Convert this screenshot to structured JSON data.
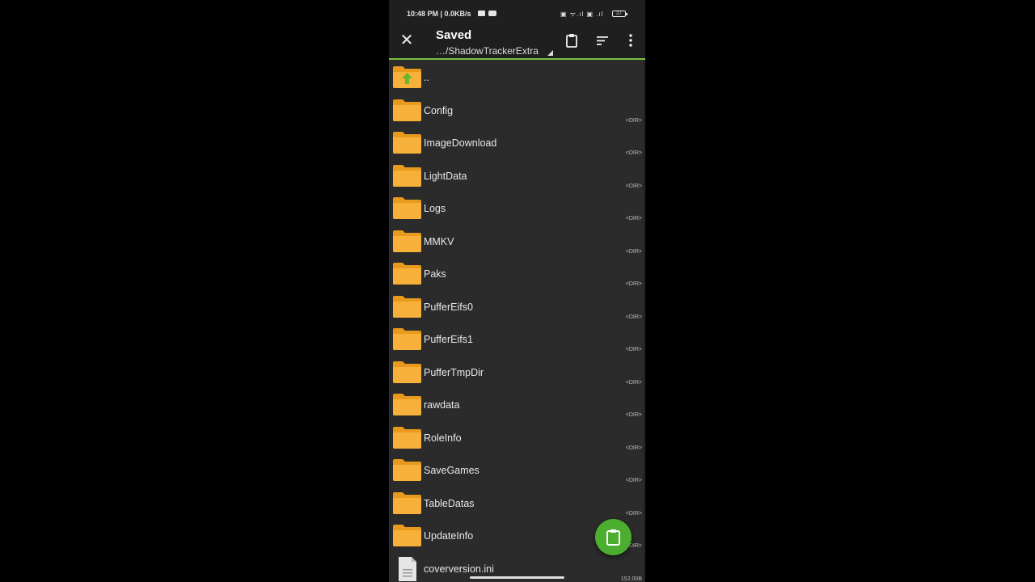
{
  "status_bar": {
    "time": "10:48 PM | 0.0KB/s",
    "system_icons": "▣ ᯤ.ıl ▣ .ıl",
    "battery": "27"
  },
  "toolbar": {
    "title": "Saved",
    "path": "…/ShadowTrackerExtra",
    "close_icon": "close-icon",
    "clipboard_icon": "clipboard-icon",
    "sort_icon": "sort-icon",
    "more_icon": "more-vertical-icon"
  },
  "files": [
    {
      "name": "..",
      "type": "parent",
      "meta": ""
    },
    {
      "name": "Config",
      "type": "dir",
      "meta": "<DIR>"
    },
    {
      "name": "ImageDownload",
      "type": "dir",
      "meta": "<DIR>"
    },
    {
      "name": "LightData",
      "type": "dir",
      "meta": "<DIR>"
    },
    {
      "name": "Logs",
      "type": "dir",
      "meta": "<DIR>"
    },
    {
      "name": "MMKV",
      "type": "dir",
      "meta": "<DIR>"
    },
    {
      "name": "Paks",
      "type": "dir",
      "meta": "<DIR>"
    },
    {
      "name": "PufferEifs0",
      "type": "dir",
      "meta": "<DIR>"
    },
    {
      "name": "PufferEifs1",
      "type": "dir",
      "meta": "<DIR>"
    },
    {
      "name": "PufferTmpDir",
      "type": "dir",
      "meta": "<DIR>"
    },
    {
      "name": "rawdata",
      "type": "dir",
      "meta": "<DIR>"
    },
    {
      "name": "RoleInfo",
      "type": "dir",
      "meta": "<DIR>"
    },
    {
      "name": "SaveGames",
      "type": "dir",
      "meta": "<DIR>"
    },
    {
      "name": "TableDatas",
      "type": "dir",
      "meta": "<DIR>"
    },
    {
      "name": "UpdateInfo",
      "type": "dir",
      "meta": "<DIR>"
    },
    {
      "name": "coverversion.ini",
      "type": "file",
      "meta": "152.00B"
    }
  ],
  "fab": {
    "icon": "paste-clipboard-icon"
  },
  "colors": {
    "accent": "#7cc142",
    "folder": "#f5a623",
    "fab": "#4cae31"
  }
}
